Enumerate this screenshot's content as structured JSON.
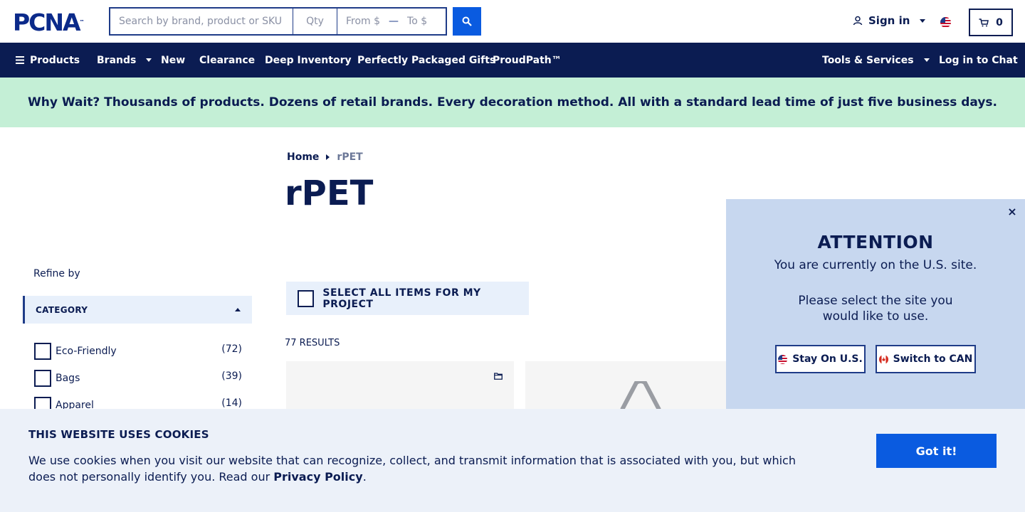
{
  "header": {
    "logo_text": "PCNA",
    "logo_tm": "™",
    "search_placeholder": "Search by brand, product or SKU",
    "qty_placeholder": "Qty",
    "price_from": "From $",
    "price_dash": "—",
    "price_to": "To $",
    "signin_label": "Sign in",
    "cart_count": "0"
  },
  "nav": {
    "products": "Products",
    "brands": "Brands",
    "new": "New",
    "clearance": "Clearance",
    "deep_inventory": "Deep Inventory",
    "gifts": "Perfectly Packaged Gifts",
    "proudpath": "ProudPath™",
    "tools": "Tools & Services",
    "chat": "Log in to Chat"
  },
  "banner": {
    "text": "Why Wait? Thousands of products. Dozens of retail brands. Every decoration method. All with a standard lead time of just five business days."
  },
  "breadcrumb": {
    "home": "Home",
    "current": "rPET"
  },
  "page_title": "rPET",
  "sidebar": {
    "refine_label": "Refine by",
    "category_label": "CATEGORY",
    "categories": [
      {
        "label": "Eco-Friendly",
        "count": "(72)"
      },
      {
        "label": "Bags",
        "count": "(39)"
      },
      {
        "label": "Apparel",
        "count": "(14)"
      }
    ]
  },
  "listing": {
    "select_all_label": "SELECT ALL ITEMS FOR MY PROJECT",
    "results_label": "77 RESULTS"
  },
  "popup": {
    "close": "×",
    "title": "ATTENTION",
    "line1": "You are currently on the U.S. site.",
    "line2": "Please select the site you would like to use.",
    "stay_label": "Stay On U.S.",
    "switch_label": "Switch to CAN"
  },
  "cookie": {
    "title": "THIS WEBSITE USES COOKIES",
    "text_before": "We use cookies when you visit our website that can recognize, collect, and transmit information that is associated with you, but which does not personally identify you. Read our ",
    "link_label": "Privacy Policy",
    "text_after": ".",
    "button_label": "Got it!"
  },
  "icons": {
    "search": "search-icon",
    "user": "user-icon",
    "flag_us": "us-flag-icon",
    "flag_ca": "canada-flag-icon",
    "cart": "cart-icon",
    "menu": "hamburger-icon",
    "folder": "folder-icon",
    "close": "close-icon"
  },
  "colors": {
    "navy": "#0b1c52",
    "brand_blue": "#0a5be0",
    "banner_green": "#c4efd6",
    "popup_blue": "#c7d7ef",
    "cookie_bg": "#ecf1f9"
  }
}
